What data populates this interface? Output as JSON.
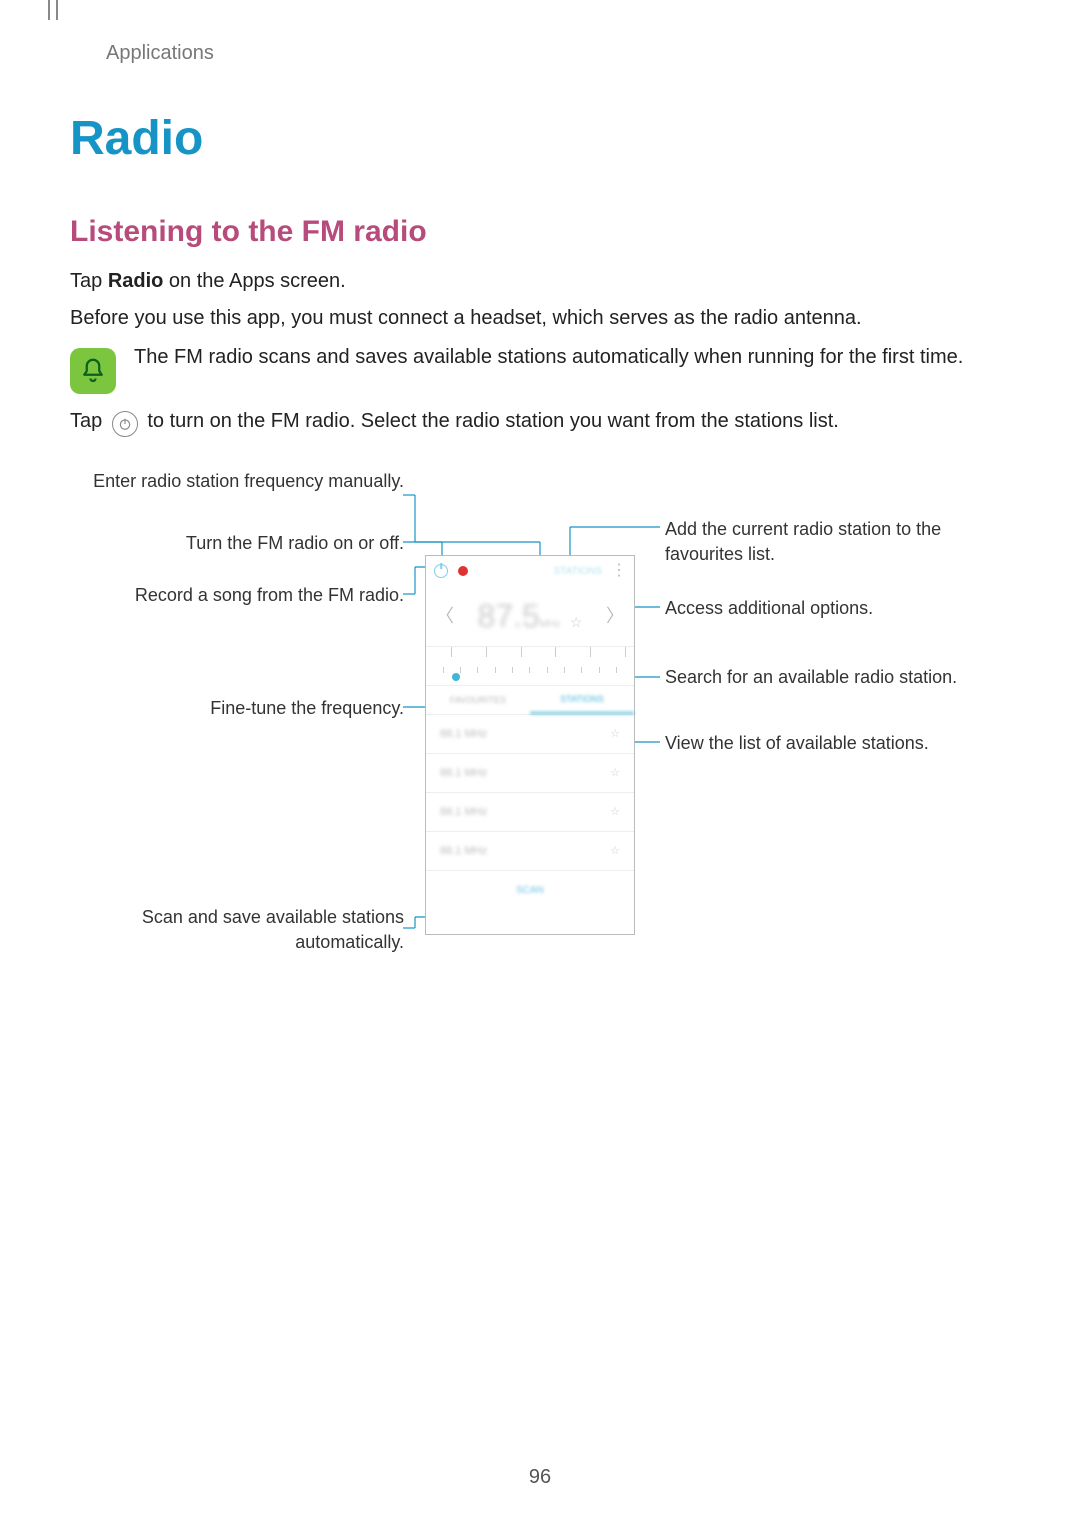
{
  "breadcrumb": "Applications",
  "title": "Radio",
  "section": "Listening to the FM radio",
  "p1_prefix": "Tap ",
  "p1_bold": "Radio",
  "p1_suffix": " on the Apps screen.",
  "p2": "Before you use this app, you must connect a headset, which serves as the radio antenna.",
  "note": "The FM radio scans and saves available stations automatically when running for the first time.",
  "p3_prefix": "Tap ",
  "p3_suffix": " to turn on the FM radio. Select the radio station you want from the stations list.",
  "callouts": {
    "l1": "Enter radio station frequency manually.",
    "l2": "Turn the FM radio on or off.",
    "l3": "Record a song from the FM radio.",
    "l4": "Fine-tune the frequency.",
    "l5": "Scan and save available stations automatically.",
    "r1": "Add the current radio station to the favourites list.",
    "r2": "Access additional options.",
    "r3": "Search for an available radio station.",
    "r4": "View the list of available stations."
  },
  "phone": {
    "freq_value": "87.5",
    "freq_unit": "MHz",
    "toolbar_text": "STATIONS",
    "tab1": "FAVOURITES",
    "tab2": "STATIONS",
    "scan_label": "SCAN",
    "station1": "88.1 MHz",
    "station2": "88.1 MHz",
    "station3": "88.1 MHz",
    "station4": "88.1 MHz"
  },
  "page_number": "96"
}
